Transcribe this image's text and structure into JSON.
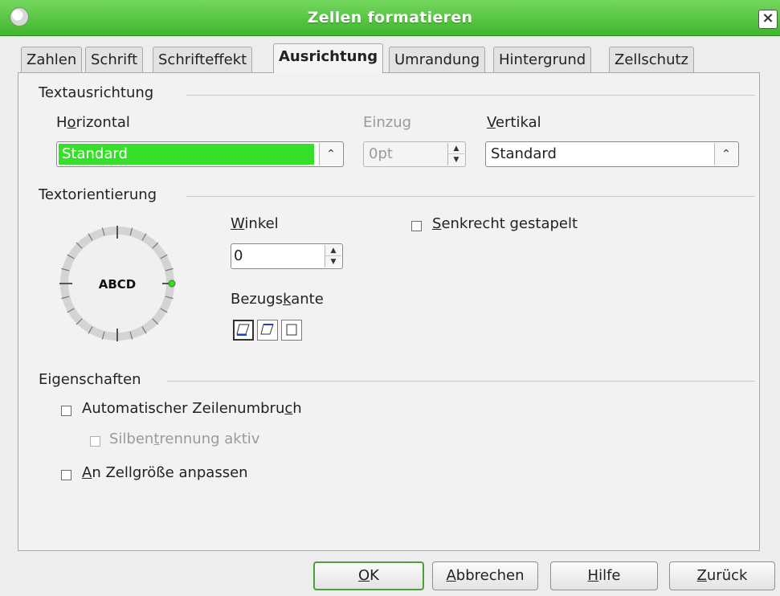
{
  "window": {
    "title": "Zellen formatieren"
  },
  "tabs": [
    {
      "label": "Zahlen"
    },
    {
      "label": "Schrift"
    },
    {
      "label": "Schrifteffekt"
    },
    {
      "label": "Ausrichtung",
      "active": true
    },
    {
      "label": "Umrandung"
    },
    {
      "label": "Hintergrund"
    },
    {
      "label": "Zellschutz"
    }
  ],
  "text_alignment": {
    "section_title": "Textausrichtung",
    "horizontal": {
      "label_before": "H",
      "label_mnemonic": "o",
      "label_after": "rizontal",
      "value": "Standard"
    },
    "indent": {
      "label_before": "Einzu",
      "label_mnemonic": "g",
      "label_after": "",
      "value": "0pt"
    },
    "vertical": {
      "label_before": "",
      "label_mnemonic": "V",
      "label_after": "ertikal",
      "value": "Standard"
    }
  },
  "text_orientation": {
    "section_title": "Textorientierung",
    "dial_text": "ABCD",
    "angle": {
      "label_before": "",
      "label_mnemonic": "W",
      "label_after": "inkel",
      "value": "0"
    },
    "stacked": {
      "label_before": "",
      "label_mnemonic": "S",
      "label_after": "enkrecht gestapelt",
      "checked": false
    },
    "reference_edge": {
      "label_before": "Bezugs",
      "label_mnemonic": "k",
      "label_after": "ante"
    }
  },
  "properties": {
    "section_title": "Eigenschaften",
    "wrap": {
      "label_before": "Automatischer Zeilenumbru",
      "label_mnemonic": "c",
      "label_after": "h",
      "checked": false
    },
    "hyphenation": {
      "label_before": "Silben",
      "label_mnemonic": "t",
      "label_after": "rennung aktiv",
      "checked": false
    },
    "shrink": {
      "label_before": "",
      "label_mnemonic": "A",
      "label_after": "n Zellgröße anpassen",
      "checked": false
    }
  },
  "buttons": {
    "ok": {
      "label_before": "",
      "label_mnemonic": "O",
      "label_after": "K"
    },
    "cancel": {
      "label_before": "",
      "label_mnemonic": "A",
      "label_after": "bbrechen"
    },
    "help": {
      "label_before": "",
      "label_mnemonic": "H",
      "label_after": "ilfe"
    },
    "reset": {
      "label_before": "",
      "label_mnemonic": "Z",
      "label_after": "urück"
    }
  },
  "colors": {
    "accent_green": "#3fb52c",
    "selection_green": "#36e02a"
  }
}
